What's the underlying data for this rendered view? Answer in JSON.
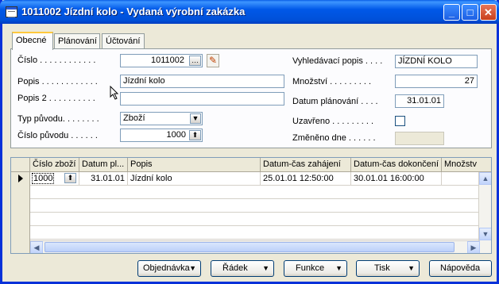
{
  "window": {
    "title": "1011002 Jízdní kolo - Vydaná výrobní zakázka"
  },
  "titlebar_buttons": {
    "minimize": "_",
    "maximize": "□",
    "close": "✕"
  },
  "tabs": [
    {
      "label": "Obecné"
    },
    {
      "label": "Plánování"
    },
    {
      "label": "Účtování"
    }
  ],
  "form": {
    "cislo": {
      "label": "Číslo . . . . . . . . . . . .",
      "value": "1011002"
    },
    "popis": {
      "label": "Popis . . . . . . . . . . . .",
      "value": "Jízdní kolo"
    },
    "popis2": {
      "label": "Popis 2 . . . . . . . . . .",
      "value": ""
    },
    "typ_puvodu": {
      "label": "Typ původu. . . . . . . .",
      "value": "Zboží"
    },
    "cislo_puvodu": {
      "label": "Číslo původu . . . . . .",
      "value": "1000"
    },
    "vyhledavaci_popis": {
      "label": "Vyhledávací popis . . . .",
      "value": "JÍZDNÍ KOLO"
    },
    "mnozstvi": {
      "label": "Množství . . . . . . . . .",
      "value": "27"
    },
    "datum_planovani": {
      "label": "Datum plánování . . . .",
      "value": "31.01.01"
    },
    "uzavreno": {
      "label": "Uzavřeno . . . . . . . . ."
    },
    "zmeneno_dne": {
      "label": "Změněno dne . . . . . .",
      "value": ""
    }
  },
  "grid": {
    "columns": [
      "Číslo zboží",
      "Datum pl...",
      "Popis",
      "Datum-čas zahájení",
      "Datum-čas dokončení",
      "Množstv"
    ],
    "rows": [
      {
        "cislo": "1000",
        "datum": "31.01.01",
        "popis": "Jízdní kolo",
        "zahajeni": "25.01.01 12:50:00",
        "dokonceni": "30.01.01 16:00:00",
        "mnozstvi": ""
      }
    ]
  },
  "buttons": {
    "objednavka": "Objednávka",
    "radek": "Řádek",
    "funkce": "Funkce",
    "tisk": "Tisk",
    "napoveda": "Nápověda"
  }
}
